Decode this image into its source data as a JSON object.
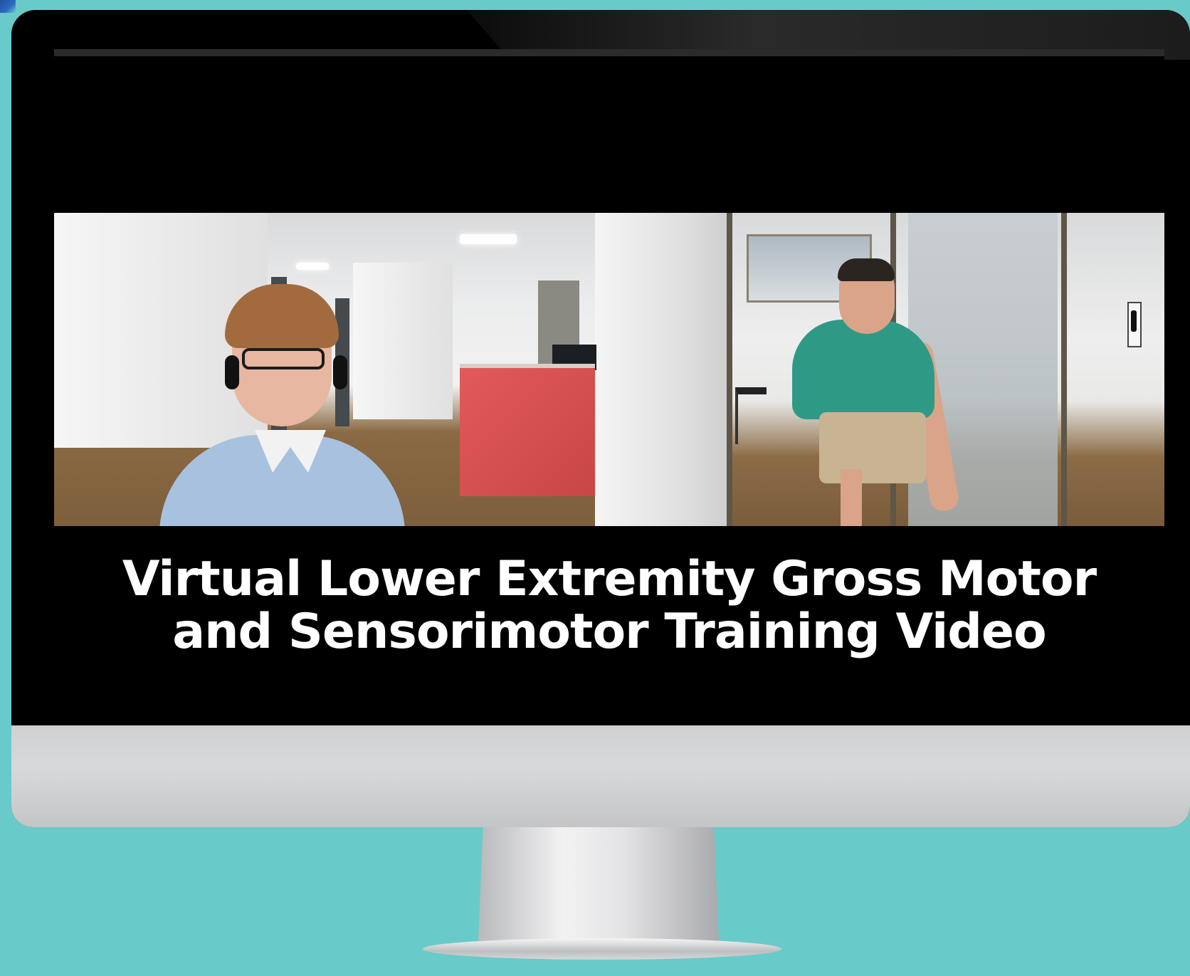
{
  "title": {
    "line1": "Virtual Lower Extremity Gross Motor",
    "line2": "and Sensorimotor Training Video"
  },
  "colors": {
    "background": "#69cbc9",
    "bezel": "#000000",
    "title_text": "#ffffff",
    "desk_red": "#d94f4f",
    "shirt_blue": "#a8c1df",
    "shirt_teal": "#2e9a86"
  },
  "icons": {
    "corner_mark": "logo-corner-icon"
  }
}
